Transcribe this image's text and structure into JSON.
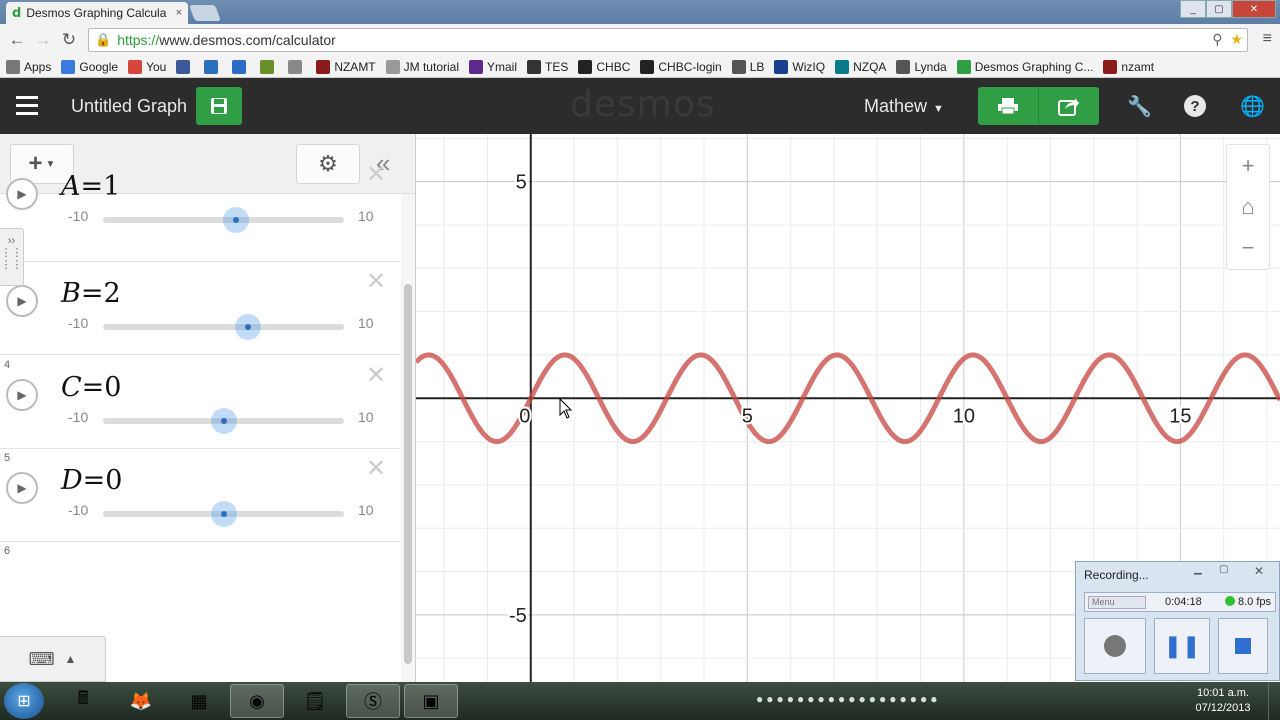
{
  "browser": {
    "tab_title": "Desmos Graphing Calcula",
    "tab_close": "×",
    "url_scheme": "https://",
    "url_rest": "www.desmos.com/calculator",
    "bookmarks": [
      {
        "label": "Apps",
        "color": "#777777"
      },
      {
        "label": "Google",
        "color": "#3b7be0"
      },
      {
        "label": "You",
        "color": "#d6463a"
      },
      {
        "label": "",
        "color": "#3b5998"
      },
      {
        "label": "",
        "color": "#2c6fbf"
      },
      {
        "label": "",
        "color": "#2b6cc4"
      },
      {
        "label": "",
        "color": "#6a8e2a"
      },
      {
        "label": "",
        "color": "#888888"
      },
      {
        "label": "NZAMT",
        "color": "#8a1c1c"
      },
      {
        "label": "JM tutorial",
        "color": "#999999"
      },
      {
        "label": "Ymail",
        "color": "#5b2a8a"
      },
      {
        "label": "TES",
        "color": "#333333"
      },
      {
        "label": "CHBC",
        "color": "#222222"
      },
      {
        "label": "CHBC-login",
        "color": "#222222"
      },
      {
        "label": "LB",
        "color": "#555555"
      },
      {
        "label": "WizIQ",
        "color": "#1a3f8f"
      },
      {
        "label": "NZQA",
        "color": "#0a7a8a"
      },
      {
        "label": "Lynda",
        "color": "#555555"
      },
      {
        "label": "Desmos Graphing C...",
        "color": "#2f9e44"
      },
      {
        "label": "nzamt",
        "color": "#8a1c1c"
      }
    ]
  },
  "desmos": {
    "graph_title": "Untitled Graph",
    "logo": "desmos",
    "user": "Mathew",
    "expressions": [
      {
        "num": "",
        "var": "A",
        "value": "1",
        "min": "-10",
        "max": "10",
        "slider_fraction": 0.55
      },
      {
        "num": "",
        "var": "B",
        "value": "2",
        "min": "-10",
        "max": "10",
        "slider_fraction": 0.6
      },
      {
        "num": "4",
        "var": "C",
        "value": "0",
        "min": "-10",
        "max": "10",
        "slider_fraction": 0.5
      },
      {
        "num": "5",
        "var": "D",
        "value": "0",
        "min": "-10",
        "max": "10",
        "slider_fraction": 0.5
      }
    ],
    "empty_row_num": "6"
  },
  "graph": {
    "x_ticks": [
      "0",
      "5",
      "10",
      "15"
    ],
    "y_ticks": [
      "5",
      "-5"
    ],
    "curve_color": "#c74440",
    "x_range": [
      -2.65,
      17.3
    ],
    "y_range": [
      -6.55,
      6.1
    ],
    "function": "y = A sin(B(x - C)) + D"
  },
  "recorder": {
    "title": "Recording...",
    "menu": "Menu",
    "time": "0:04:18",
    "fps": "8.0 fps"
  },
  "taskbar": {
    "time": "10:01 a.m.",
    "date": "07/12/2013"
  }
}
